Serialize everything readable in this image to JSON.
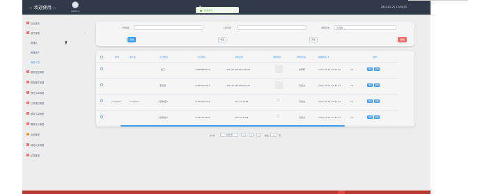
{
  "header": {
    "welcome": "---欢迎使用---",
    "user_name": "admin ▾",
    "system_title": "统",
    "datetime": "2025-02-21 15:50:53",
    "toast": "修改成功"
  },
  "sidebar": {
    "items": [
      {
        "label": "后台首页",
        "icon_color": "#f56c6c"
      },
      {
        "label": "用户管理",
        "icon_color": "#f56c6c",
        "caret": "^"
      },
      {
        "label": "管理员",
        "icon_color": ""
      },
      {
        "label": "普通用户",
        "icon_color": ""
      },
      {
        "label": "审核人员",
        "icon_color": ""
      },
      {
        "label": "服务类型管理",
        "icon_color": "#f56c6c"
      },
      {
        "label": "审核服务管理",
        "icon_color": "#f56c6c"
      },
      {
        "label": "预约订单管理",
        "icon_color": "#f56c6c"
      },
      {
        "label": "订单预约管理",
        "icon_color": "#f56c6c"
      },
      {
        "label": "服务订单管理",
        "icon_color": "#f56c6c"
      },
      {
        "label": "服务评价管理",
        "icon_color": "#f56c6c"
      },
      {
        "label": "系统管理",
        "icon_color": "#e6a23c"
      },
      {
        "label": "网站公告管理",
        "icon_color": "#f56c6c"
      },
      {
        "label": "反馈管理",
        "icon_color": "#f56c6c"
      }
    ]
  },
  "search": {
    "name_label": "人员姓名",
    "name_placeholder": "",
    "phone_label": "人员手机",
    "phone_placeholder": "",
    "status_label": "审核状态",
    "status_placeholder": "请选择",
    "search_button": "查询",
    "reset_button": "重置",
    "add_button": "添加",
    "delete_button": "删除"
  },
  "table": {
    "columns": [
      "账号",
      "用户名",
      "人员姓名",
      "人员手机",
      "身份证号",
      "服务照片",
      "审核状态",
      "提醒时间 ↕",
      "",
      "操作"
    ],
    "rows": [
      {
        "account": "",
        "username": "",
        "name": "张三",
        "phone": "13888888433",
        "id_card": "441421199901010202",
        "photo": "placeholder",
        "status": "未审核",
        "time": "2025-02-21 15:39:52",
        "extra": "20"
      },
      {
        "account": "",
        "username": "",
        "name": "李四四",
        "phone": "15828319787",
        "id_card": "441421199980000101",
        "photo": "placeholder",
        "status": "已通过",
        "time": "2025-02-21 15:34:33",
        "extra": "20"
      },
      {
        "account": "yongfen3",
        "username": "yongfen3",
        "name": "人员姓名2",
        "phone": "17852536754",
        "id_card": "111-47-4519",
        "photo": "loading",
        "status": "已通过",
        "time": "2025-02-21 15:34:33",
        "extra": "20"
      },
      {
        "account": "",
        "username": "",
        "name": "人员姓名3",
        "phone": "17853323238",
        "id_card": "420-45-1603",
        "photo": "loading",
        "status": "已通过",
        "time": "2025-02-21 15:34:33",
        "extra": "20"
      }
    ],
    "action_edit": "详情",
    "action_view": "编辑"
  },
  "pagination": {
    "total": "共4条",
    "page_size": "10条/页",
    "prev": "<",
    "current_page": "1",
    "next": ">",
    "goto_label": "前往",
    "goto_value": "1",
    "page_unit": "页"
  },
  "colors": {
    "header_bg": "#303a49",
    "accent": "#409eff",
    "danger": "#f56c6c",
    "success": "#67c23a",
    "bottom_bar": "#b8372f"
  }
}
